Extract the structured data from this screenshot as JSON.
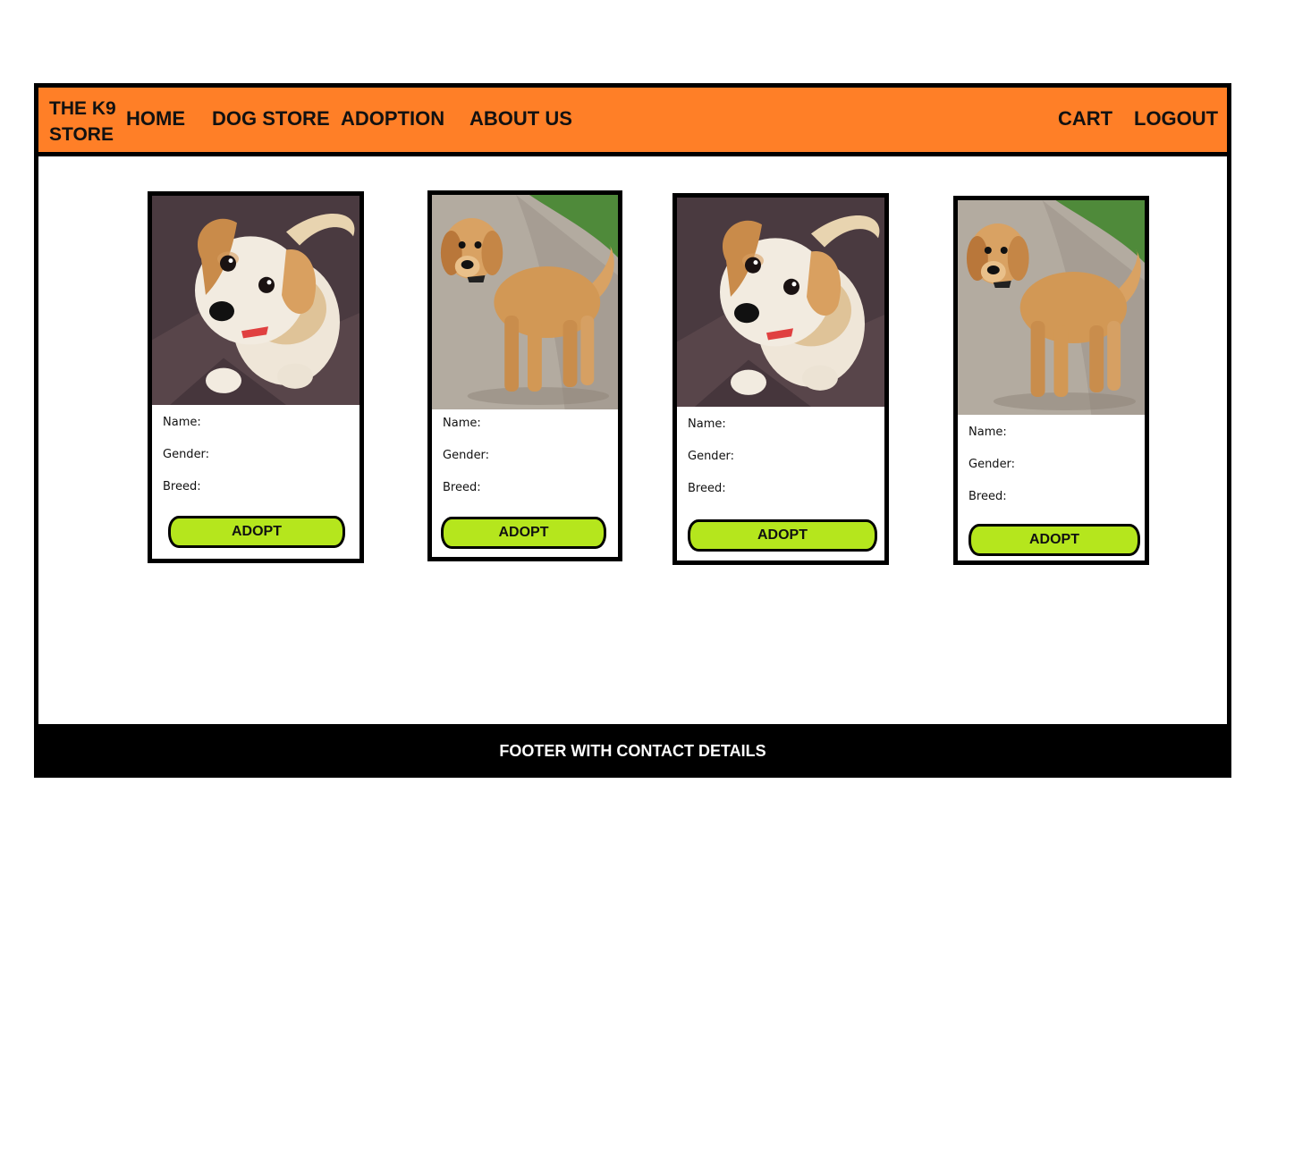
{
  "header": {
    "brand_line1": "THE K9",
    "brand_line2": "STORE",
    "nav": {
      "home": "HOME",
      "dog_store": "DOG STORE",
      "adoption": "ADOPTION",
      "about_us": "ABOUT US",
      "cart": "CART",
      "logout": "LOGOUT"
    }
  },
  "cards": [
    {
      "image": "puppy-sitting-photo",
      "name_label": "Name:",
      "gender_label": "Gender:",
      "breed_label": "Breed:",
      "button_label": "ADOPT"
    },
    {
      "image": "golden-puppy-standing-photo",
      "name_label": "Name:",
      "gender_label": "Gender:",
      "breed_label": "Breed:",
      "button_label": "ADOPT"
    },
    {
      "image": "puppy-sitting-photo",
      "name_label": "Name:",
      "gender_label": "Gender:",
      "breed_label": "Breed:",
      "button_label": "ADOPT"
    },
    {
      "image": "golden-puppy-standing-photo",
      "name_label": "Name:",
      "gender_label": "Gender:",
      "breed_label": "Breed:",
      "button_label": "ADOPT"
    }
  ],
  "footer": {
    "text": "FOOTER WITH CONTACT DETAILS"
  },
  "colors": {
    "header_bg": "#ff7f27",
    "button_bg": "#b5e61d",
    "footer_bg": "#000000",
    "border": "#000000"
  }
}
